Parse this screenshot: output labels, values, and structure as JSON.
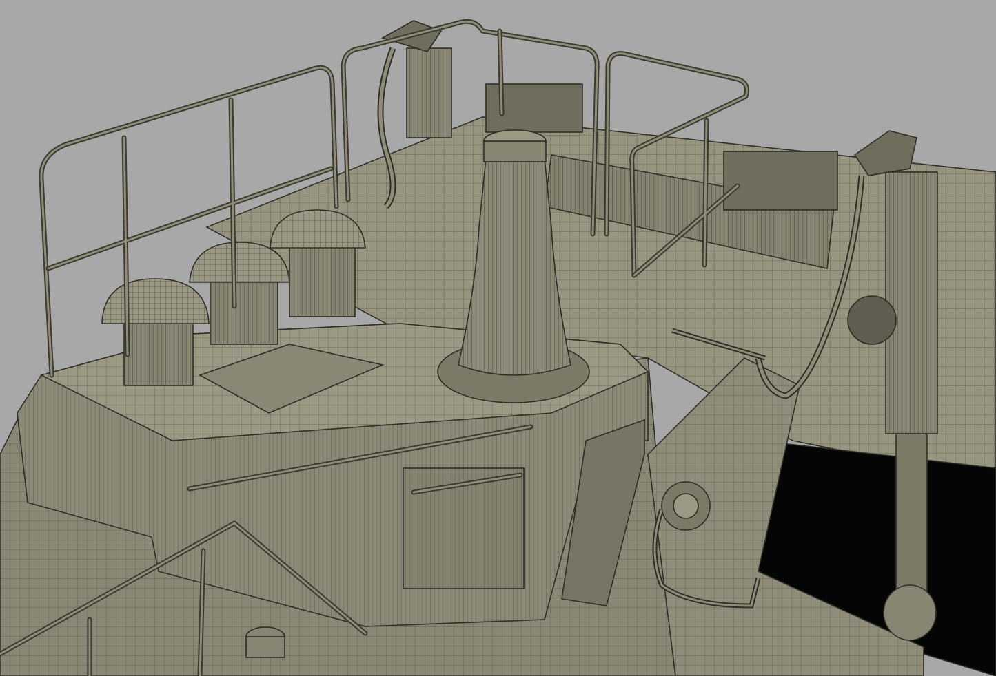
{
  "scene": {
    "subject": "wireframe-3d-model",
    "colors": {
      "background": "#a8a8a8",
      "surface": "#8e8c78",
      "surface_light": "#9d9b86",
      "surface_dark": "#6f6d5c",
      "wire": "#2e2e26",
      "void": "#050505"
    }
  }
}
